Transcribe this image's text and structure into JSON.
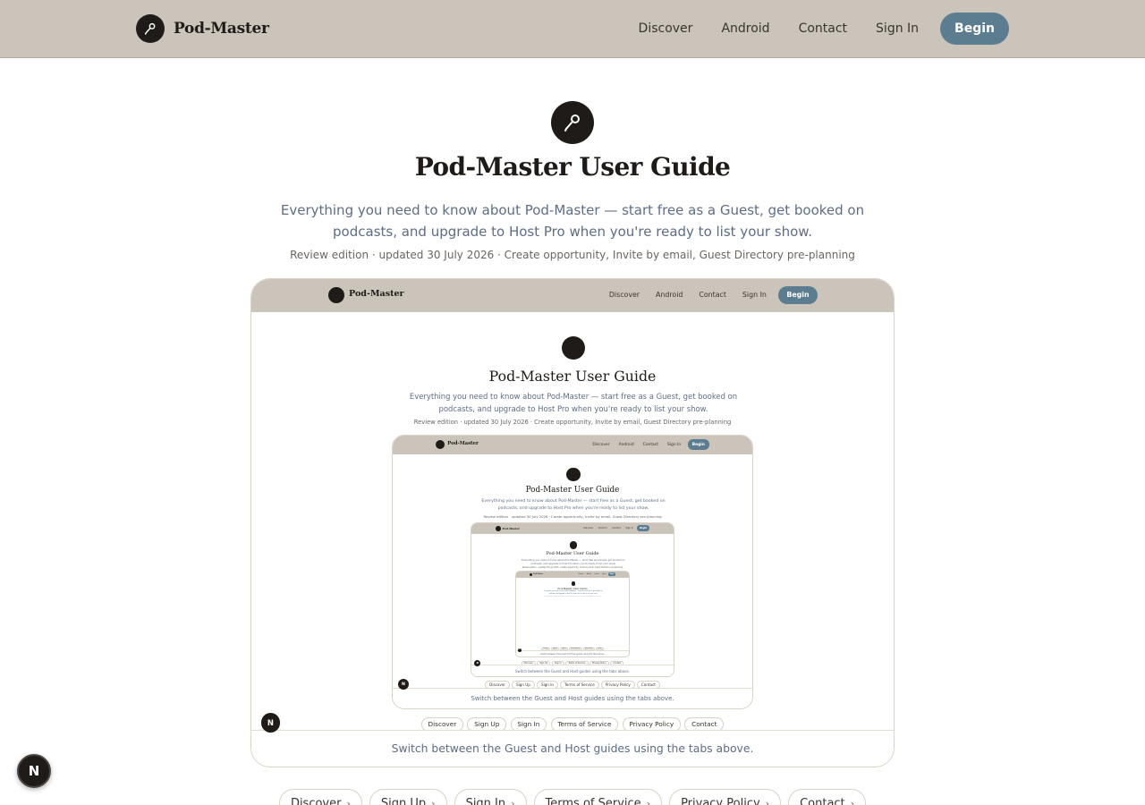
{
  "header": {
    "brand": "Pod-Master",
    "nav": [
      "Discover",
      "Android",
      "Contact",
      "Sign In"
    ],
    "cta": "Begin"
  },
  "hero": {
    "title": "Pod-Master User Guide",
    "subtitle": "Everything you need to know about Pod-Master — start free as a Guest, get booked on podcasts, and upgrade to Host Pro when you're ready to list your show.",
    "meta": "Review edition · updated 30 July 2026 · Create opportunity, Invite by email, Guest Directory pre-planning"
  },
  "preview": {
    "footer_note": "Switch between the Guest and Host guides using the tabs above."
  },
  "footer_links": [
    "Discover",
    "Sign Up",
    "Sign In",
    "Terms of Service",
    "Privacy Policy",
    "Contact"
  ],
  "badge": "N",
  "icons": {
    "brand": "microphone-icon",
    "link": "chevron-right-icon"
  },
  "colors": {
    "header_bg": "#cbc4ba",
    "accent": "#5b7d8f",
    "ink": "#1f1b18",
    "muted": "#5f6d83"
  }
}
